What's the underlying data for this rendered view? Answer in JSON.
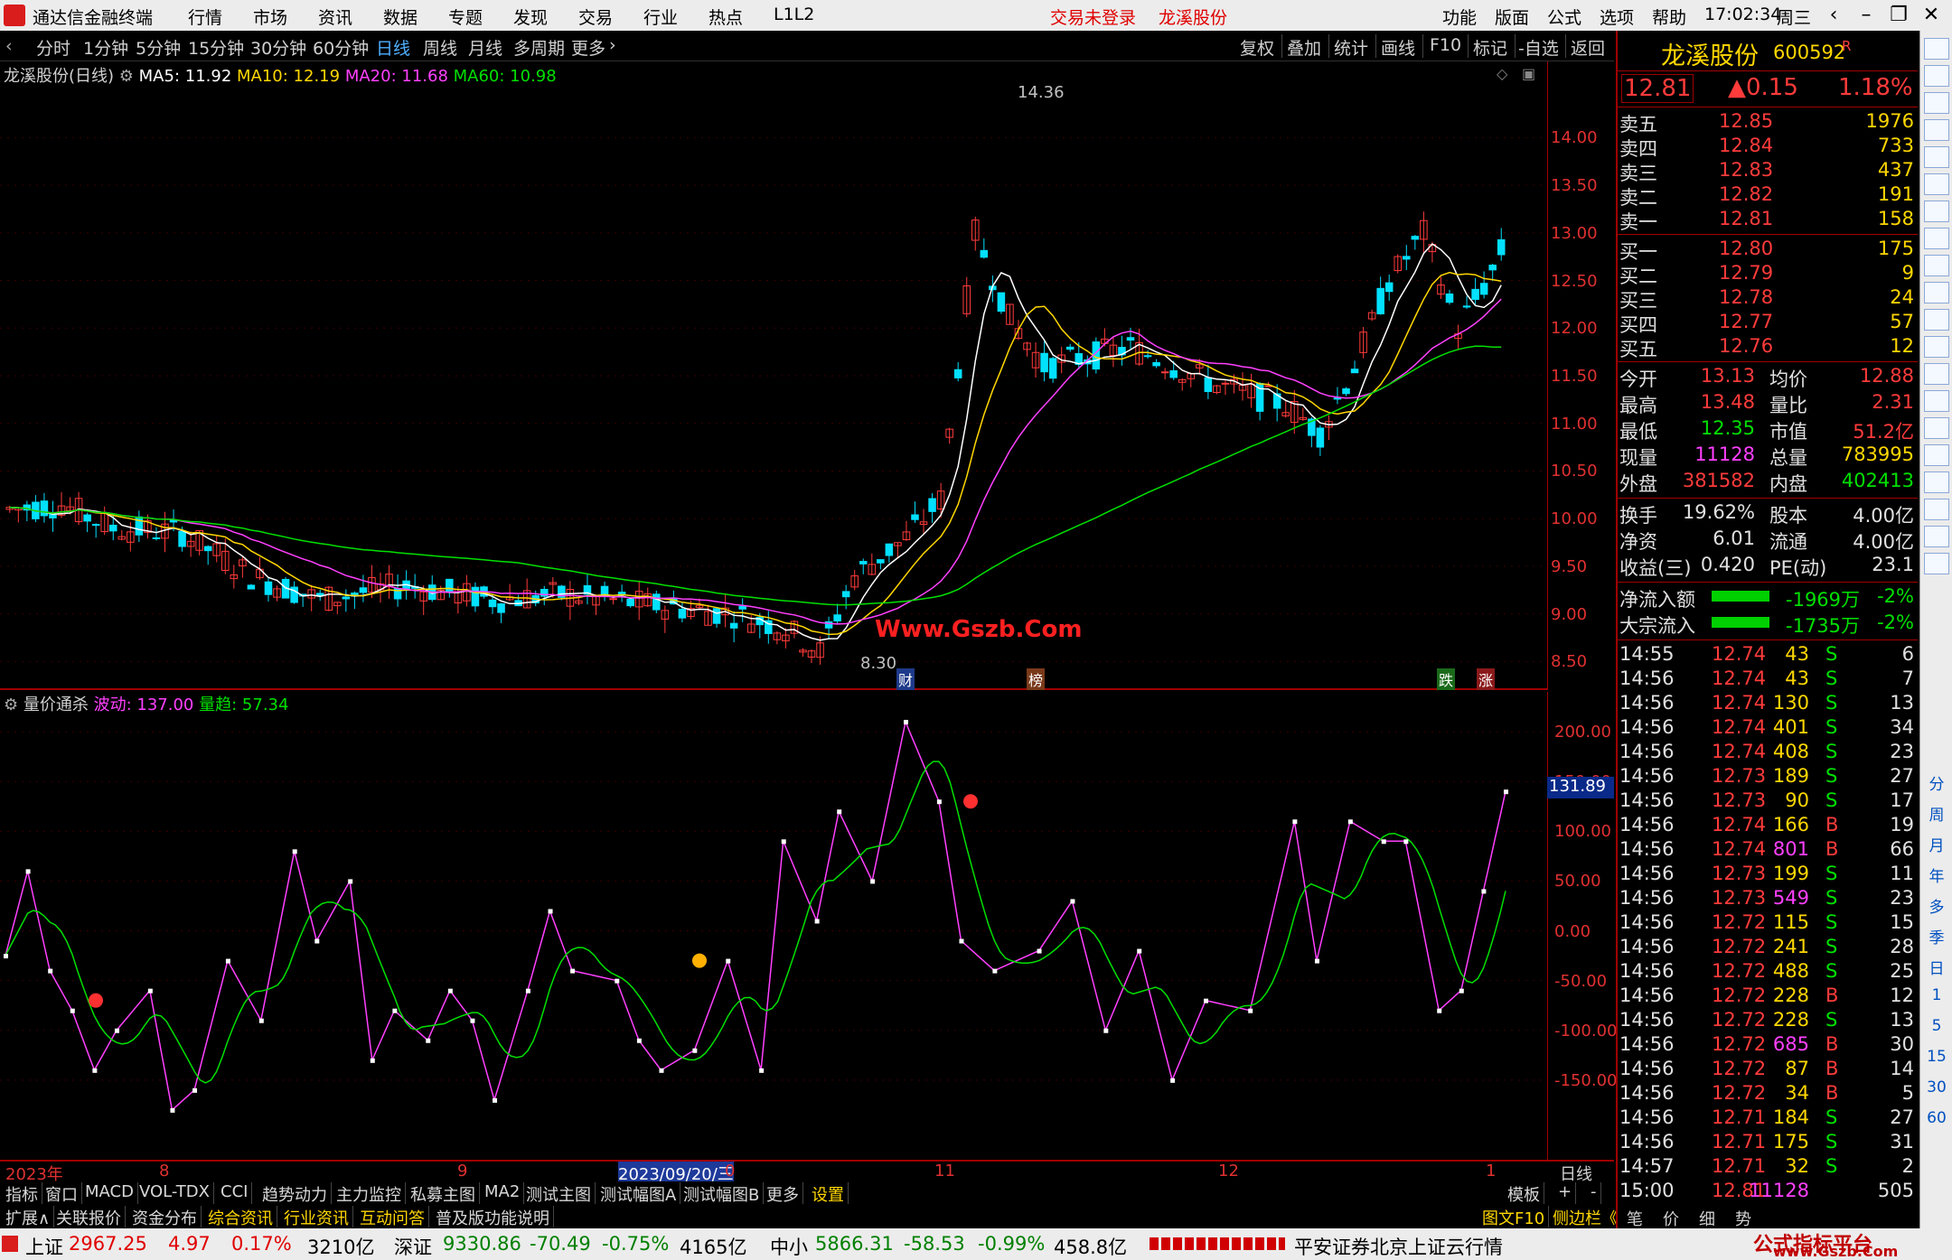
{
  "titlebar": {
    "app_name": "通达信金融终端",
    "menus": [
      "行情",
      "市场",
      "资讯",
      "数据",
      "专题",
      "发现",
      "交易",
      "行业",
      "热点",
      "L1L2"
    ],
    "trade_status": "交易未登录",
    "stock_name": "龙溪股份",
    "right_menus": [
      "功能",
      "版面",
      "公式",
      "选项",
      "帮助"
    ],
    "time": "17:02:34",
    "weekday": "周三"
  },
  "toolbar": {
    "periods": [
      "分时",
      "1分钟",
      "5分钟",
      "15分钟",
      "30分钟",
      "60分钟",
      "日线",
      "周线",
      "月线",
      "多周期",
      "更多"
    ],
    "active": "日线",
    "tools": [
      "复权",
      "叠加",
      "统计",
      "画线",
      "F10",
      "标记",
      "-自选",
      "返回"
    ]
  },
  "main_chart": {
    "stock_label": "龙溪股份(日线)",
    "ma5": "MA5: 11.92",
    "ma10": "MA10: 12.19",
    "ma20": "MA20: 11.68",
    "ma60": "MA60: 10.98",
    "high_label": "14.36",
    "low_label": "8.30",
    "watermark": "Www.Gszb.Com",
    "markers": [
      "财",
      "榜",
      "跌",
      "涨"
    ],
    "y_ticks": [
      "14.00",
      "13.50",
      "13.00",
      "12.50",
      "12.00",
      "11.50",
      "11.00",
      "10.50",
      "10.00",
      "9.50",
      "9.00",
      "8.50"
    ]
  },
  "indicator": {
    "name": "量价通杀",
    "wave": "波动: 137.00",
    "trend": "量趋: 57.34",
    "y_ticks": [
      "200.00",
      "150.00",
      "100.00",
      "50.00",
      "0.00",
      "-50.00",
      "-100.00",
      "-150.00"
    ],
    "current": "131.89"
  },
  "time_axis": {
    "labels": [
      "2023年",
      "8",
      "9",
      "2023/09/20/三",
      "0",
      "11",
      "12",
      "1"
    ],
    "period": "日线"
  },
  "tabs_row1": [
    "指标",
    "窗口",
    "MACD",
    "VOL-TDX",
    "CCI",
    "趋势动力",
    "主力监控",
    "私募主图",
    "MA2",
    "测试主图",
    "测试幅图A",
    "测试幅图B",
    "更多",
    "设置"
  ],
  "tabs_row1_right": [
    "模板",
    "+",
    "-"
  ],
  "tabs_row2": [
    "扩展∧",
    "关联报价",
    "资金分布",
    "综合资讯",
    "行业资讯",
    "互动问答",
    "普及版功能说明"
  ],
  "tabs_row2_right": [
    "图文F10",
    "侧边栏《",
    "笔",
    "价",
    "细",
    "势"
  ],
  "statusbar": {
    "sh": "上证",
    "sh_v": "2967.25",
    "sh_c": "4.97",
    "sh_p": "0.17%",
    "sh_a": "3210亿",
    "sz": "深证",
    "sz_v": "9330.86",
    "sz_c": "-70.49",
    "sz_p": "-0.75%",
    "sz_a": "4165亿",
    "zx": "中小",
    "zx_v": "5866.31",
    "zx_c": "-58.53",
    "zx_p": "-0.99%",
    "zx_a": "458.8亿",
    "broker": "平安证券北京上证云行情",
    "brand": "公式指标平台",
    "brand_url": "www.Gszb.Com"
  },
  "quote": {
    "name": "龙溪股份",
    "code": "600592",
    "flag": "R",
    "price": "12.81",
    "change": "▲0.15",
    "pct": "1.18%",
    "asks": [
      [
        "卖五",
        "12.85",
        "1976"
      ],
      [
        "卖四",
        "12.84",
        "733"
      ],
      [
        "卖三",
        "12.83",
        "437"
      ],
      [
        "卖二",
        "12.82",
        "191"
      ],
      [
        "卖一",
        "12.81",
        "158"
      ]
    ],
    "bids": [
      [
        "买一",
        "12.80",
        "175"
      ],
      [
        "买二",
        "12.79",
        "9"
      ],
      [
        "买三",
        "12.78",
        "24"
      ],
      [
        "买四",
        "12.77",
        "57"
      ],
      [
        "买五",
        "12.76",
        "12"
      ]
    ],
    "stats": [
      [
        "今开",
        "13.13",
        "均价",
        "12.88"
      ],
      [
        "最高",
        "13.48",
        "量比",
        "2.31"
      ],
      [
        "最低",
        "12.35",
        "市值",
        "51.2亿"
      ],
      [
        "现量",
        "11128",
        "总量",
        "783995"
      ],
      [
        "外盘",
        "381582",
        "内盘",
        "402413"
      ]
    ],
    "stats2": [
      [
        "换手",
        "19.62%",
        "股本",
        "4.00亿"
      ],
      [
        "净资",
        "6.01",
        "流通",
        "4.00亿"
      ],
      [
        "收益(三)",
        "0.420",
        "PE(动)",
        "23.1"
      ]
    ],
    "flows": [
      [
        "净流入额",
        "-1969万",
        "-2%"
      ],
      [
        "大宗流入",
        "-1735万",
        "-2%"
      ]
    ],
    "ticks": [
      [
        "14:55",
        "12.74",
        "43",
        "S",
        "6"
      ],
      [
        "14:56",
        "12.74",
        "43",
        "S",
        "7"
      ],
      [
        "14:56",
        "12.74",
        "130",
        "S",
        "13"
      ],
      [
        "14:56",
        "12.74",
        "401",
        "S",
        "34"
      ],
      [
        "14:56",
        "12.74",
        "408",
        "S",
        "23"
      ],
      [
        "14:56",
        "12.73",
        "189",
        "S",
        "27"
      ],
      [
        "14:56",
        "12.73",
        "90",
        "S",
        "17"
      ],
      [
        "14:56",
        "12.74",
        "166",
        "B",
        "19"
      ],
      [
        "14:56",
        "12.74",
        "801",
        "B",
        "66"
      ],
      [
        "14:56",
        "12.73",
        "199",
        "S",
        "11"
      ],
      [
        "14:56",
        "12.73",
        "549",
        "S",
        "23"
      ],
      [
        "14:56",
        "12.72",
        "115",
        "S",
        "15"
      ],
      [
        "14:56",
        "12.72",
        "241",
        "S",
        "28"
      ],
      [
        "14:56",
        "12.72",
        "488",
        "S",
        "25"
      ],
      [
        "14:56",
        "12.72",
        "228",
        "B",
        "12"
      ],
      [
        "14:56",
        "12.72",
        "228",
        "S",
        "13"
      ],
      [
        "14:56",
        "12.72",
        "685",
        "B",
        "30"
      ],
      [
        "14:56",
        "12.72",
        "87",
        "B",
        "14"
      ],
      [
        "14:56",
        "12.72",
        "34",
        "B",
        "5"
      ],
      [
        "14:56",
        "12.71",
        "184",
        "S",
        "27"
      ],
      [
        "14:56",
        "12.71",
        "175",
        "S",
        "31"
      ],
      [
        "14:57",
        "12.71",
        "32",
        "S",
        "2"
      ],
      [
        "15:00",
        "12.81",
        "11128",
        "",
        "505"
      ]
    ]
  },
  "sidebar": [
    "分",
    "周",
    "月",
    "年",
    "多",
    "季",
    "日",
    "1",
    "5",
    "15",
    "30",
    "60"
  ],
  "colors": {
    "up": "#ff3b3b",
    "down": "#00e0ff",
    "ma5": "#ffffff",
    "ma10": "#ffd700",
    "ma20": "#ff40ff",
    "ma60": "#00e000",
    "wave": "#ff40ff",
    "trend": "#00e000"
  }
}
